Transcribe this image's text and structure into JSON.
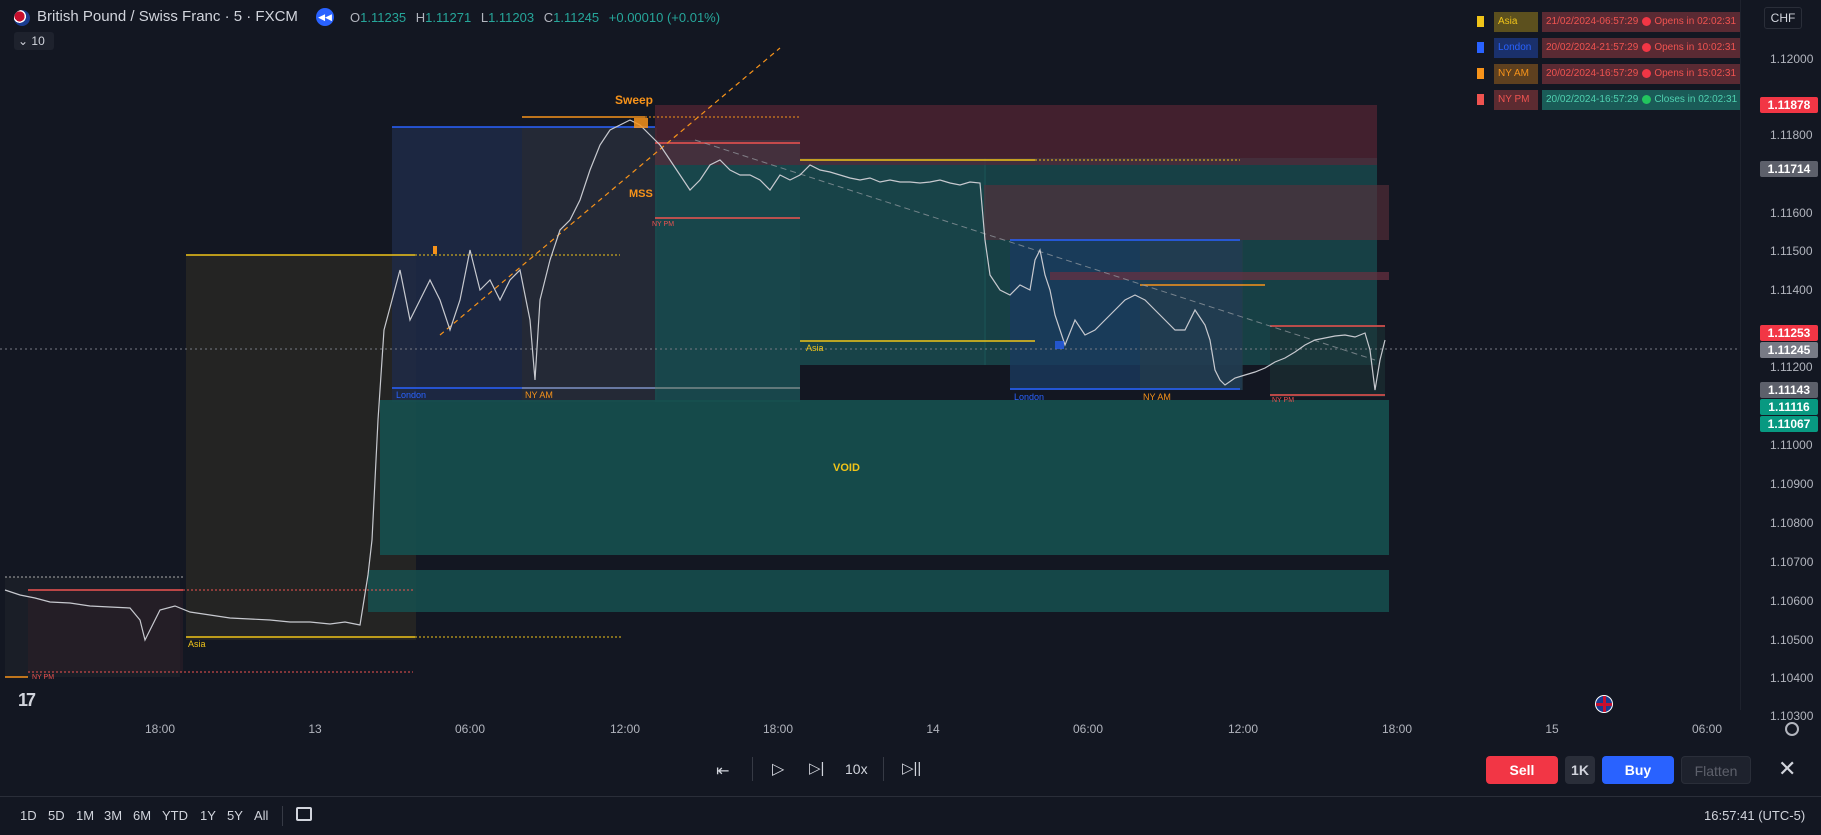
{
  "header": {
    "symbol": "British Pound / Swiss Franc · 5 · FXCM",
    "ohlc": {
      "o_label": "O",
      "o": "1.11235",
      "h_label": "H",
      "h": "1.11271",
      "l_label": "L",
      "l": "1.11203",
      "c_label": "C",
      "c": "1.11245",
      "change": "+0.00010 (+0.01%)"
    },
    "indicator_count": "10"
  },
  "currency_button": "CHF",
  "sessions": [
    {
      "name": "Asia",
      "time": "21/02/2024-06:57:29",
      "status": "Opens in 02:02:31",
      "color": "#f0c419",
      "state": "closed"
    },
    {
      "name": "London",
      "time": "20/02/2024-21:57:29",
      "status": "Opens in 10:02:31",
      "color": "#2962ff",
      "state": "closed"
    },
    {
      "name": "NY AM",
      "time": "20/02/2024-16:57:29",
      "status": "Opens in 15:02:31",
      "color": "#f7931a",
      "state": "closed"
    },
    {
      "name": "NY PM",
      "time": "20/02/2024-16:57:29",
      "status": "Closes in 02:02:31",
      "color": "#ef5350",
      "state": "open"
    }
  ],
  "price_axis": {
    "ticks": [
      "1.12000",
      "1.11800",
      "1.11600",
      "1.11500",
      "1.11400",
      "1.11200",
      "1.11000",
      "1.10900",
      "1.10800",
      "1.10700",
      "1.10600",
      "1.10500",
      "1.10400",
      "1.10300"
    ],
    "tags": [
      {
        "value": "1.11878",
        "bg": "#f23645"
      },
      {
        "value": "1.11714",
        "bg": "#5d606b"
      },
      {
        "value": "1.11253",
        "bg": "#f23645"
      },
      {
        "value": "1.11245",
        "bg": "#787b86"
      },
      {
        "value": "1.11143",
        "bg": "#5d606b"
      },
      {
        "value": "1.11116",
        "bg": "#089981"
      },
      {
        "value": "1.11067",
        "bg": "#089981"
      }
    ]
  },
  "time_axis": [
    "18:00",
    "13",
    "06:00",
    "12:00",
    "18:00",
    "14",
    "06:00",
    "12:00",
    "18:00",
    "15",
    "06:00"
  ],
  "annotations": {
    "sweep": "Sweep",
    "mss": "MSS",
    "void": "VOID",
    "session_labels": [
      "Asia",
      "London",
      "NY AM",
      "NY PM",
      "Asia",
      "London",
      "NY AM",
      "NY PM",
      "NY PM",
      "NY PM"
    ]
  },
  "replay": {
    "speed": "10x"
  },
  "trade": {
    "sell": "Sell",
    "qty": "1K",
    "buy": "Buy",
    "flatten": "Flatten"
  },
  "ranges": [
    "1D",
    "5D",
    "1M",
    "3M",
    "6M",
    "YTD",
    "1Y",
    "5Y",
    "All"
  ],
  "clock": "16:57:41 (UTC-5)"
}
